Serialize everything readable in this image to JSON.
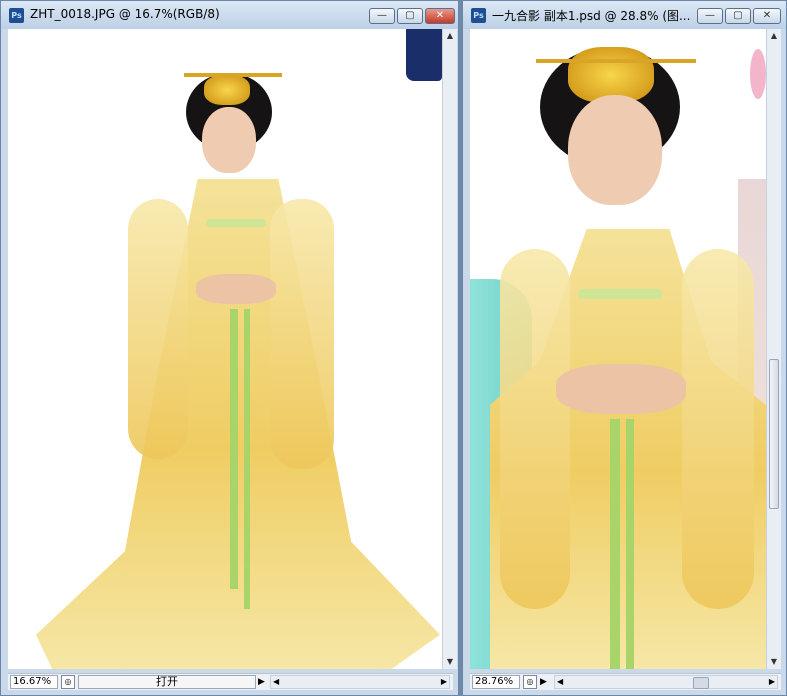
{
  "left_window": {
    "title": "ZHT_0018.JPG @ 16.7%(RGB/8)",
    "icon_label": "Ps",
    "zoom": "16.67%",
    "status_field": "打开",
    "controls": {
      "minimize": "—",
      "maximize": "▢",
      "close": "✕"
    }
  },
  "right_window": {
    "title": "一九合影 副本1.psd @ 28.8% (图...",
    "icon_label": "Ps",
    "zoom": "28.76%",
    "controls": {
      "minimize": "—",
      "maximize": "▢",
      "close": "✕"
    }
  },
  "colors": {
    "robe": "#efcd63",
    "sash": "#a8d46a",
    "hair": "#151313",
    "teal_garment": "#7fd8d0"
  }
}
